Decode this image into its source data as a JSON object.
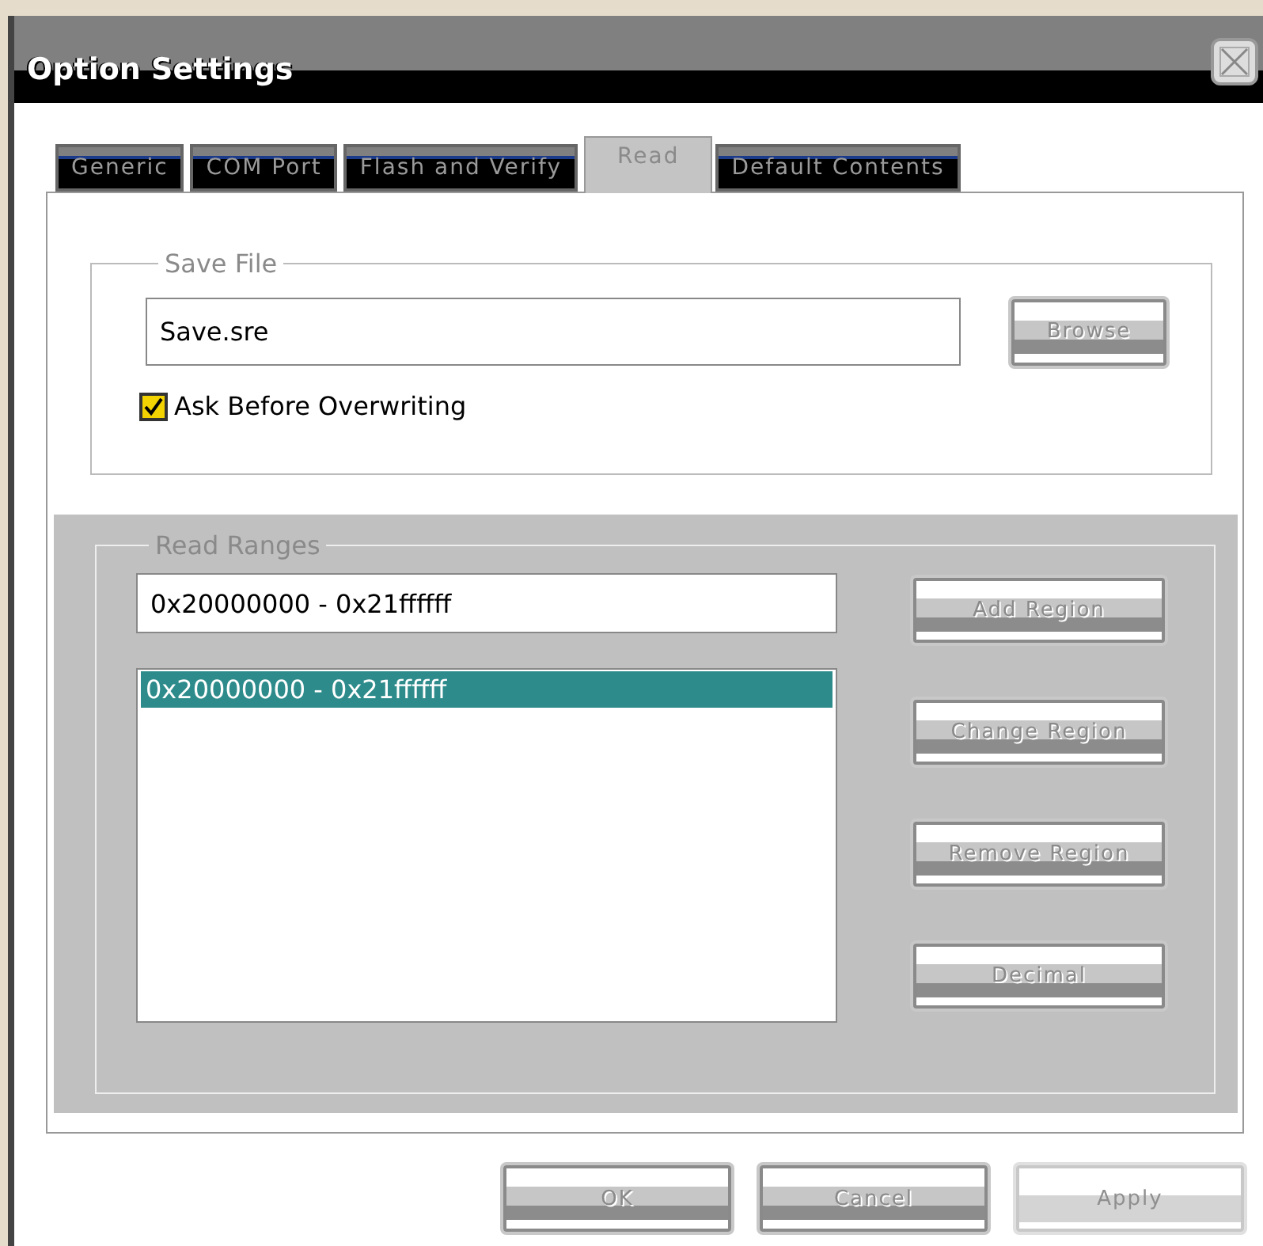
{
  "window": {
    "title": "Option Settings"
  },
  "tabs": [
    {
      "label": "Generic",
      "selected": false
    },
    {
      "label": "COM Port",
      "selected": false
    },
    {
      "label": "Flash and Verify",
      "selected": false
    },
    {
      "label": "Read",
      "selected": true
    },
    {
      "label": "Default Contents",
      "selected": false
    }
  ],
  "save_file": {
    "legend": "Save File",
    "file_name": "Save.sre",
    "browse_button": {
      "label": "Browse",
      "disabled": false
    },
    "ask_checkbox": {
      "label": "Ask Before Overwriting",
      "checked": true
    }
  },
  "read_ranges": {
    "legend": "Read Ranges",
    "range_input": "0x20000000 - 0x21ffffff",
    "list": [
      {
        "text": "0x20000000 - 0x21ffffff",
        "selected": true
      }
    ],
    "buttons": [
      {
        "label": "Add Region",
        "disabled": false
      },
      {
        "label": "Change Region",
        "disabled": false
      },
      {
        "label": "Remove Region",
        "disabled": false
      },
      {
        "label": "Decimal",
        "disabled": false
      }
    ]
  },
  "buttons": [
    {
      "label": "OK",
      "disabled": false
    },
    {
      "label": "Cancel",
      "disabled": false
    },
    {
      "label": "Apply",
      "disabled": true
    }
  ]
}
